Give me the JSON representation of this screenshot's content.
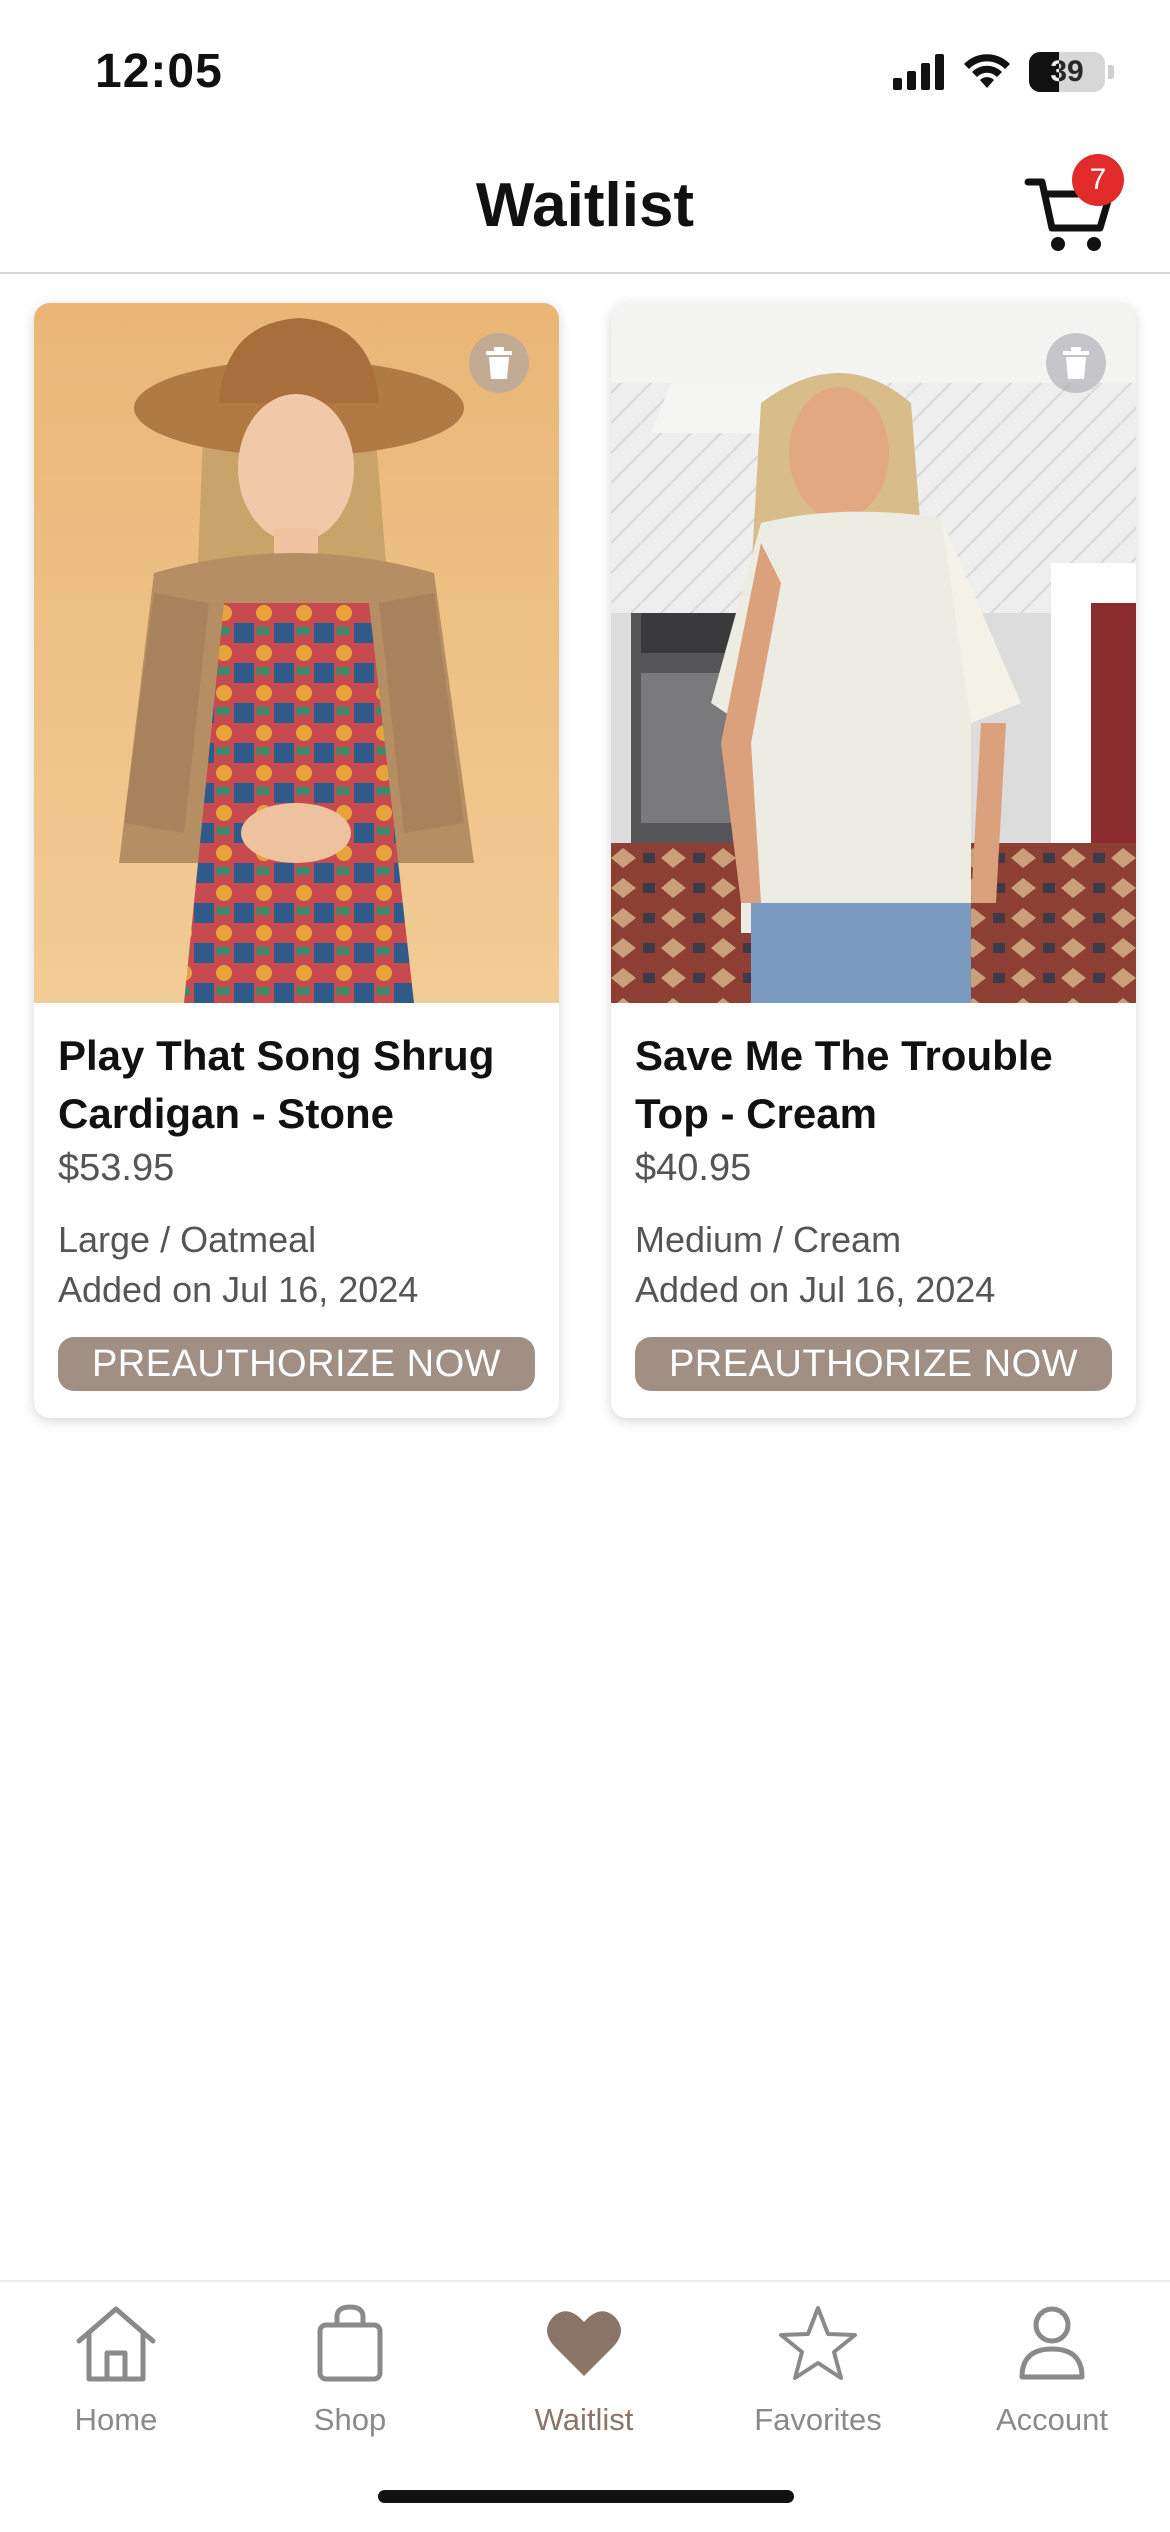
{
  "status_bar": {
    "time": "12:05",
    "battery_level": "39",
    "battery_fraction": 0.39,
    "icons": [
      "cellular-signal-icon",
      "wifi-icon",
      "battery-icon"
    ]
  },
  "header": {
    "title": "Waitlist",
    "cart_count": "7",
    "cart_icon": "cart-icon",
    "badge_color": "#e22b2b"
  },
  "products": [
    {
      "name": "Play That Song Shrug Cardigan - Stone",
      "price": "$53.95",
      "variant": "Large / Oatmeal",
      "added": "Added on Jul 16, 2024",
      "button_label": "PREAUTHORIZE NOW",
      "image_alt": "Model in brown wide-brim hat and crochet cardigan over colorful patterned dress"
    },
    {
      "name": "Save Me The Trouble Top - Cream",
      "price": "$40.95",
      "variant": "Medium / Cream",
      "added": "Added on Jul 16, 2024",
      "button_label": "PREAUTHORIZE NOW",
      "image_alt": "Model in cream top with lace sleeves and jeans in a kitchen"
    }
  ],
  "tab_bar": {
    "tabs": [
      {
        "label": "Home",
        "icon": "home-icon"
      },
      {
        "label": "Shop",
        "icon": "shopping-bag-icon"
      },
      {
        "label": "Waitlist",
        "icon": "heart-icon",
        "active": true
      },
      {
        "label": "Favorites",
        "icon": "star-icon"
      },
      {
        "label": "Account",
        "icon": "person-icon"
      }
    ]
  },
  "colors": {
    "accent": "#a28f83",
    "active_tab": "#8a7468",
    "inactive_tab": "#8a8a8a"
  }
}
